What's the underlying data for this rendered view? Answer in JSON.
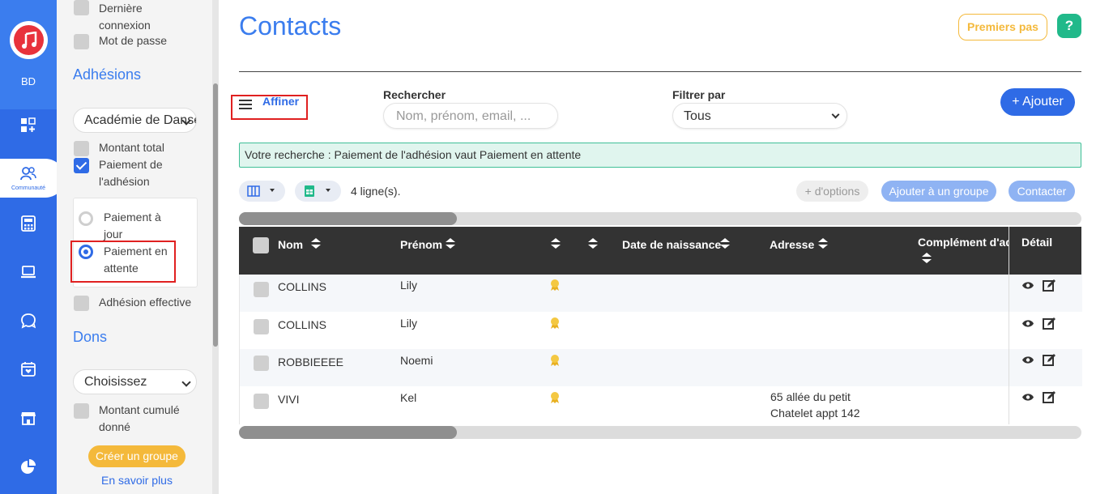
{
  "rail": {
    "initials": "BD",
    "active_label": "Communauté"
  },
  "filters": {
    "items_top": [
      "Dernière connexion",
      "Mot de passe"
    ],
    "adhesions_heading": "Adhésions",
    "adhesions_select": "Académie de Danse",
    "montant_total": "Montant total",
    "paiement_adhesion": "Paiement de l'adhésion",
    "radio_a_jour": "Paiement à jour",
    "radio_en_attente": "Paiement en attente",
    "adhesion_effective": "Adhésion effective",
    "dons_heading": "Dons",
    "dons_select": "Choisissez",
    "montant_cumule": "Montant cumulé donné",
    "create_group": "Créer un groupe",
    "learn_more": "En savoir plus"
  },
  "header": {
    "title": "Contacts",
    "premiers_pas": "Premiers pas",
    "help": "?"
  },
  "toolbar": {
    "affiner": "Affiner",
    "search_label": "Rechercher",
    "search_placeholder": "Nom, prénom, email, ...",
    "filter_label": "Filtrer par",
    "filter_value": "Tous",
    "add_button": "+ Ajouter"
  },
  "notice": "Votre recherche : Paiement de l'adhésion vaut Paiement en attente",
  "table_tools": {
    "rows_count": "4 ligne(s).",
    "more_options": "+ d'options",
    "add_to_group": "Ajouter à un groupe",
    "contact": "Contacter"
  },
  "table": {
    "columns": [
      "Nom",
      "Prénom",
      "Date de naissance",
      "Adresse",
      "Complément d'adresse",
      "Détail"
    ],
    "rows": [
      {
        "nom": "COLLINS",
        "prenom": "Lily",
        "adresse1": "",
        "adresse2": ""
      },
      {
        "nom": "COLLINS",
        "prenom": "Lily",
        "adresse1": "",
        "adresse2": ""
      },
      {
        "nom": "ROBBIEEEE",
        "prenom": "Noemi",
        "adresse1": "",
        "adresse2": ""
      },
      {
        "nom": "VIVI",
        "prenom": "Kel",
        "adresse1": "65 allée du petit",
        "adresse2": "Chatelet appt 142"
      }
    ]
  },
  "colors": {
    "primary": "#2f6be6",
    "accent": "#f4b93b",
    "success": "#21b98a",
    "highlight": "#e02020",
    "header_dark": "#333333"
  }
}
